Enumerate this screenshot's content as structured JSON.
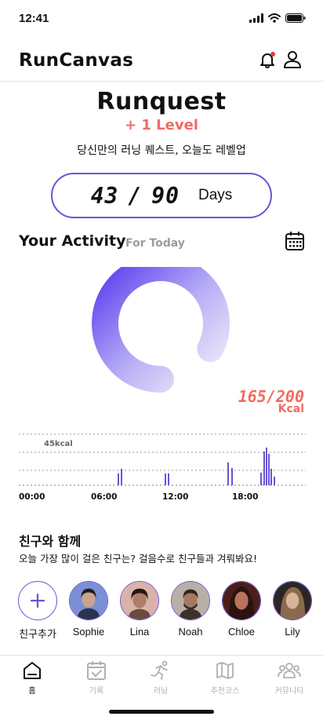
{
  "status": {
    "time": "12:41"
  },
  "app": {
    "name": "RunCanvas"
  },
  "quest": {
    "title": "Runquest",
    "level_up": "+ 1 Level",
    "subtitle": "당신만의 러닝 퀘스트, 오늘도 레벨업",
    "days_current": "43",
    "days_total": "90",
    "days_separator": "/",
    "days_label": "Days"
  },
  "activity": {
    "title": "Your Activity",
    "period": "For Today",
    "kcal_value": "165/200",
    "kcal_unit": "Kcal",
    "progress": 0.825,
    "chart_label": "45kcal",
    "time_labels": [
      "00:00",
      "06:00",
      "12:00",
      "18:00"
    ]
  },
  "friends": {
    "title": "친구와 함께",
    "subtitle": "오늘 가장 많이 걸은 친구는? 걸음수로 친구들과 겨뤄봐요!",
    "add_label": "친구추가",
    "list": [
      {
        "name": "Sophie",
        "color": "#3c4a6e"
      },
      {
        "name": "Lina",
        "color": "#7a5245"
      },
      {
        "name": "Noah",
        "color": "#4b3c34"
      },
      {
        "name": "Chloe",
        "color": "#5b2a22"
      },
      {
        "name": "Lily",
        "color": "#3a3230"
      }
    ]
  },
  "tabs": [
    {
      "label": "홈",
      "icon": "home-icon",
      "active": true
    },
    {
      "label": "기록",
      "icon": "calendar-check-icon",
      "active": false
    },
    {
      "label": "러닝",
      "icon": "runner-icon",
      "active": false
    },
    {
      "label": "추천코스",
      "icon": "map-icon",
      "active": false
    },
    {
      "label": "커뮤니티",
      "icon": "community-icon",
      "active": false
    }
  ],
  "colors": {
    "accent": "#6a54d6",
    "highlight": "#f26b62"
  }
}
